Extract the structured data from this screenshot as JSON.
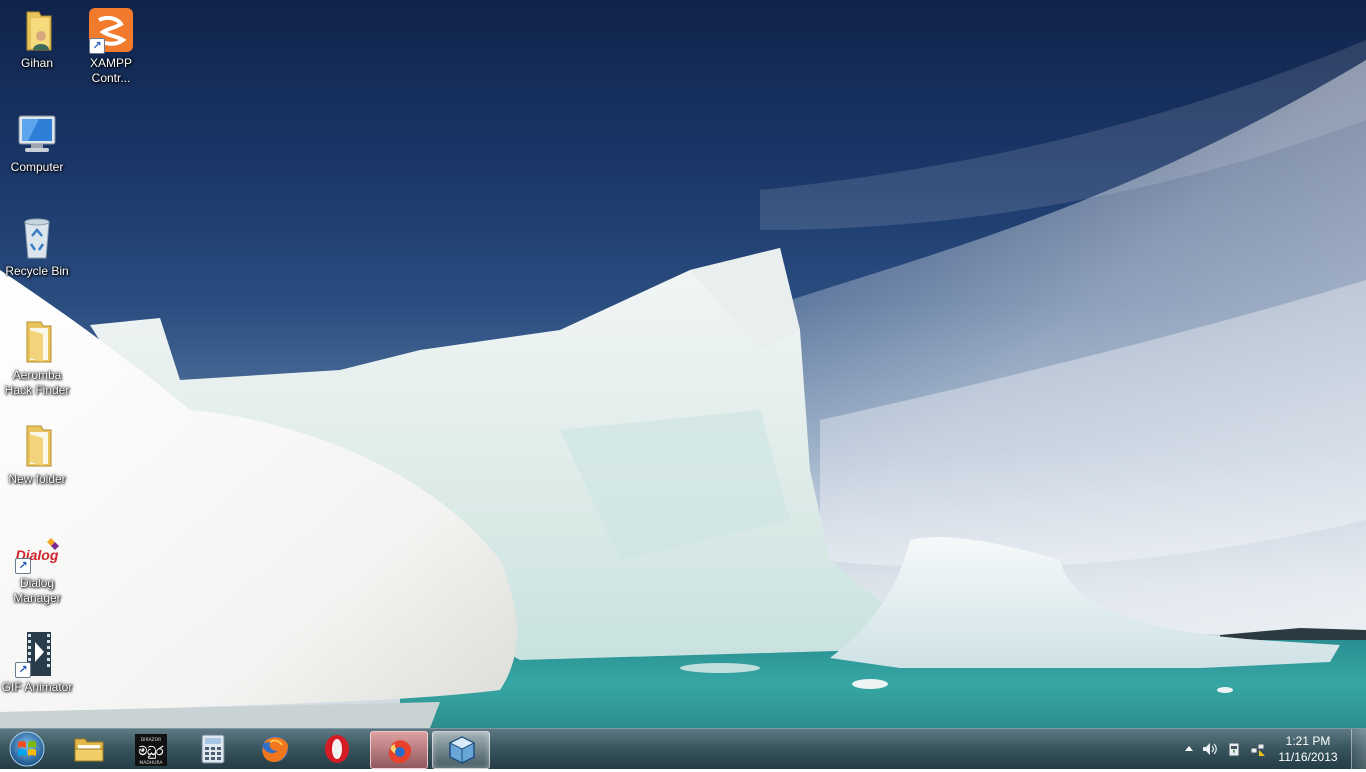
{
  "desktop": {
    "icons": [
      {
        "label": "Gihan",
        "icon": "user-folder-icon"
      },
      {
        "label": "XAMPP Contr...",
        "icon": "xampp-icon",
        "glyph": "ꝺ"
      },
      {
        "label": "Computer",
        "icon": "computer-icon"
      },
      {
        "label": "Recycle Bin",
        "icon": "recycle-bin-icon"
      },
      {
        "label": "Aeromba Hack Finder",
        "icon": "folder-icon"
      },
      {
        "label": "New folder",
        "icon": "folder-icon"
      },
      {
        "label": "Dialog Manager",
        "icon": "dialog-icon",
        "logo_text": "Dialog"
      },
      {
        "label": "GIF Animator",
        "icon": "film-icon"
      }
    ]
  },
  "taskbar": {
    "start": "start-orb-icon",
    "pinned": [
      {
        "icon": "windows-explorer-icon"
      },
      {
        "icon": "madhura-icon",
        "text_top": "DIRAZOR",
        "text_mid": "මධුර",
        "text_bot": "MADHURA"
      },
      {
        "icon": "calculator-icon"
      },
      {
        "icon": "firefox-icon"
      },
      {
        "icon": "opera-icon"
      },
      {
        "icon": "firefox-nightly-icon"
      },
      {
        "icon": "virtualbox-icon"
      }
    ],
    "tray": {
      "overflow": "show-hidden-icons-icon",
      "volume": "volume-icon",
      "power": "power-icon",
      "network": "network-icon",
      "time": "1:21 PM",
      "date": "11/16/2013"
    }
  },
  "colors": {
    "sky": "#1a3667",
    "ice": "#eef4f6",
    "water": "#3aa6a3",
    "taskbar": "#2f5560"
  }
}
